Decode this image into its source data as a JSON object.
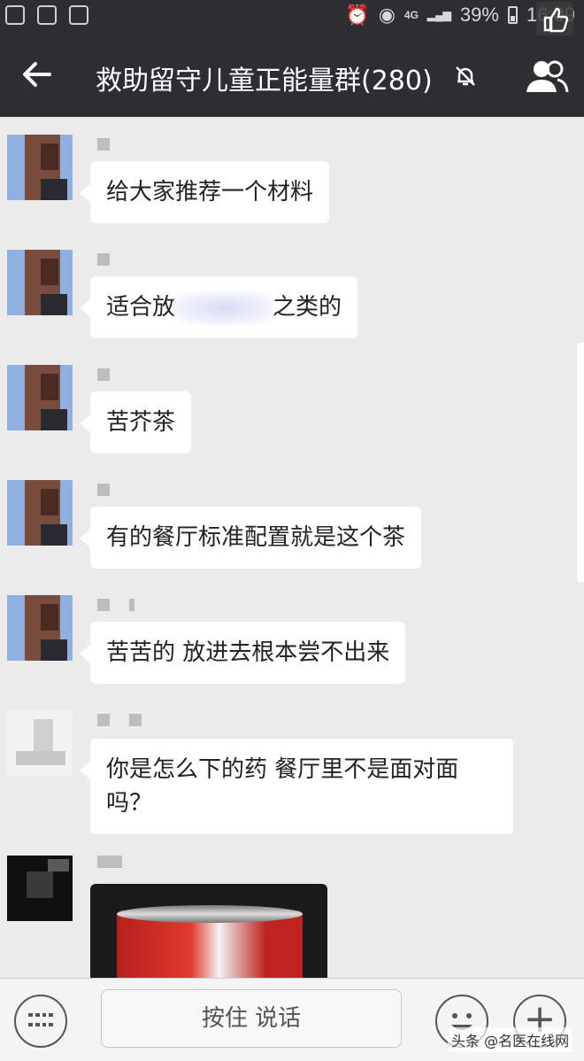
{
  "status_bar": {
    "network": "4G",
    "battery": "39%",
    "time": "16:09"
  },
  "header": {
    "title": "救助留守儿童正能量群(280)"
  },
  "messages": [
    {
      "text": "给大家推荐一个材料"
    },
    {
      "text_before": "适合放",
      "text_after": "之类的"
    },
    {
      "text": "苦芥茶"
    },
    {
      "text": "有的餐厅标准配置就是这个茶"
    },
    {
      "text": "苦苦的 放进去根本尝不出来"
    },
    {
      "line1": "你是怎么下的药  餐厅里不是面对面",
      "line2": "吗？"
    }
  ],
  "input_bar": {
    "hold_to_talk": "按住 说话"
  },
  "watermark": "头条 @名医在线网",
  "colors": {
    "header_bg": "#2d2e32",
    "chat_bg": "#ebebeb",
    "bubble_bg": "#ffffff"
  }
}
